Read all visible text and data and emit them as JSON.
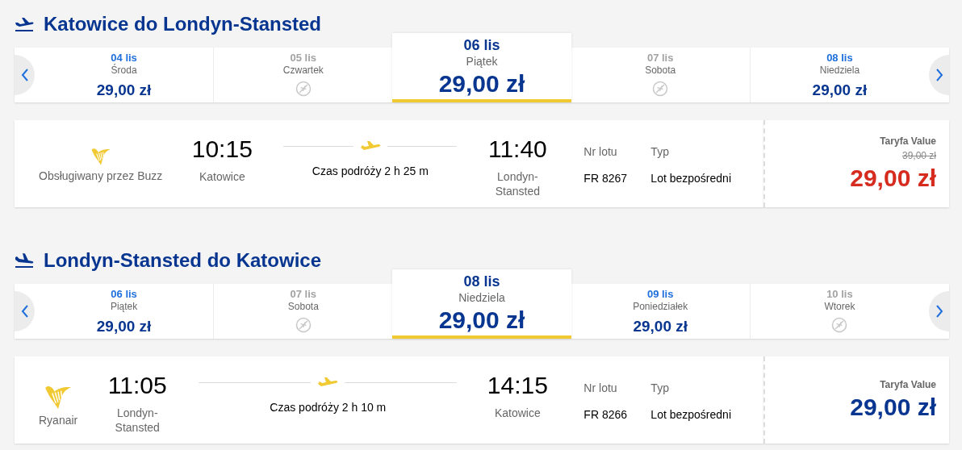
{
  "sections": [
    {
      "kind": "outbound",
      "title": "Katowice do Londyn-Stansted",
      "days": [
        {
          "date": "04 lis",
          "weekday": "Środa",
          "price": "29,00 zł",
          "available": true,
          "selected": false
        },
        {
          "date": "05 lis",
          "weekday": "Czwartek",
          "available": false,
          "selected": false
        },
        {
          "date": "06 lis",
          "weekday": "Piątek",
          "price": "29,00 zł",
          "available": true,
          "selected": true
        },
        {
          "date": "07 lis",
          "weekday": "Sobota",
          "available": false,
          "selected": false
        },
        {
          "date": "08 lis",
          "weekday": "Niedziela",
          "price": "29,00 zł",
          "available": true,
          "selected": false
        }
      ],
      "flight": {
        "airline": "Obsługiwany przez Buzz",
        "departure_time": "10:15",
        "departure_city": "Katowice",
        "duration": "Czas podróży 2 h 25 m",
        "arrival_time": "11:40",
        "arrival_city": "Londyn-Stansted",
        "flight_number_label": "Nr lotu",
        "flight_number": "FR 8267",
        "type_label": "Typ",
        "type": "Lot bezpośredni",
        "fare": "Taryfa Value",
        "original_price": "39,00 zł",
        "price": "29,00 zł"
      }
    },
    {
      "kind": "return",
      "title": "Londyn-Stansted do Katowice",
      "days": [
        {
          "date": "06 lis",
          "weekday": "Piątek",
          "price": "29,00 zł",
          "available": true,
          "selected": false
        },
        {
          "date": "07 lis",
          "weekday": "Sobota",
          "available": false,
          "selected": false
        },
        {
          "date": "08 lis",
          "weekday": "Niedziela",
          "price": "29,00 zł",
          "available": true,
          "selected": true
        },
        {
          "date": "09 lis",
          "weekday": "Poniedziałek",
          "price": "29,00 zł",
          "available": true,
          "selected": false
        },
        {
          "date": "10 lis",
          "weekday": "Wtorek",
          "available": false,
          "selected": false
        }
      ],
      "flight": {
        "airline": "Ryanair",
        "departure_time": "11:05",
        "departure_city": "Londyn-Stansted",
        "duration": "Czas podróży 2 h 10 m",
        "arrival_time": "14:15",
        "arrival_city": "Katowice",
        "flight_number_label": "Nr lotu",
        "flight_number": "FR 8266",
        "type_label": "Typ",
        "type": "Lot bezpośredni",
        "fare": "Taryfa Value",
        "price": "29,00 zł"
      }
    }
  ]
}
